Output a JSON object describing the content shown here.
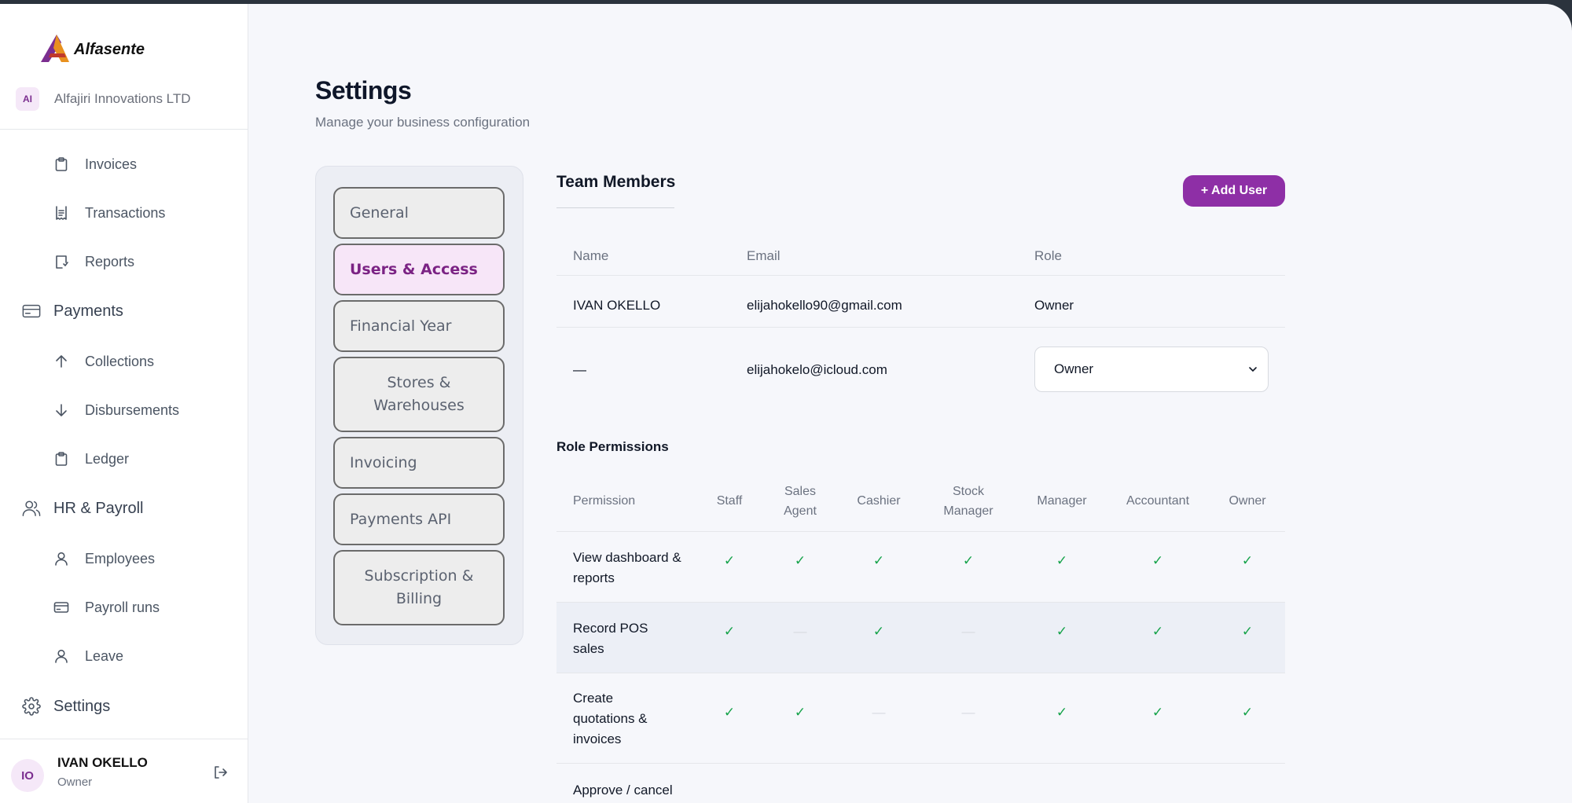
{
  "app": {
    "brand": "Alfasente",
    "org_initials": "AI",
    "org_name": "Alfajiri Innovations LTD"
  },
  "sidebar": {
    "items": [
      {
        "label": "Invoices",
        "icon": "clipboard-icon"
      },
      {
        "label": "Transactions",
        "icon": "receipt-icon"
      },
      {
        "label": "Reports",
        "icon": "report-icon"
      },
      {
        "label": "Payments",
        "icon": "card-icon"
      },
      {
        "label": "Collections",
        "icon": "arrow-up-icon"
      },
      {
        "label": "Disbursements",
        "icon": "arrow-down-icon"
      },
      {
        "label": "Ledger",
        "icon": "clipboard-icon"
      },
      {
        "label": "HR & Payroll",
        "icon": "users-icon"
      },
      {
        "label": "Employees",
        "icon": "user-icon"
      },
      {
        "label": "Payroll runs",
        "icon": "card-icon"
      },
      {
        "label": "Leave",
        "icon": "user-icon"
      },
      {
        "label": "Settings",
        "icon": "gear-icon"
      }
    ]
  },
  "user": {
    "initials": "IO",
    "name": "IVAN OKELLO",
    "role": "Owner"
  },
  "header": {
    "title": "Settings",
    "subtitle": "Manage your business configuration"
  },
  "tabs": [
    {
      "label": "General"
    },
    {
      "label": "Users & Access"
    },
    {
      "label": "Financial Year"
    },
    {
      "label": "Stores & Warehouses"
    },
    {
      "label": "Invoicing"
    },
    {
      "label": "Payments API"
    },
    {
      "label": "Subscription & Billing"
    }
  ],
  "team": {
    "title": "Team Members",
    "add_label": "+ Add User",
    "columns": [
      "Name",
      "Email",
      "Role"
    ],
    "rows": [
      {
        "name": "IVAN OKELLO",
        "email": "elijahokello90@gmail.com",
        "role": "Owner"
      },
      {
        "name": "—",
        "email": "elijahokelo@icloud.com",
        "role": "Owner"
      }
    ]
  },
  "permissions": {
    "title": "Role Permissions",
    "columns": [
      "Permission",
      "Staff",
      "Sales Agent",
      "Cashier",
      "Stock Manager",
      "Manager",
      "Accountant",
      "Owner"
    ],
    "yes_mark": "✓",
    "no_mark": "—",
    "rows": [
      {
        "name": "View dashboard & reports",
        "values": [
          true,
          true,
          true,
          true,
          true,
          true,
          true
        ]
      },
      {
        "name": "Record POS sales",
        "values": [
          true,
          false,
          true,
          false,
          true,
          true,
          true
        ]
      },
      {
        "name": "Create quotations & invoices",
        "values": [
          true,
          true,
          false,
          false,
          true,
          true,
          true
        ]
      },
      {
        "name": "Approve / cancel"
      }
    ]
  }
}
